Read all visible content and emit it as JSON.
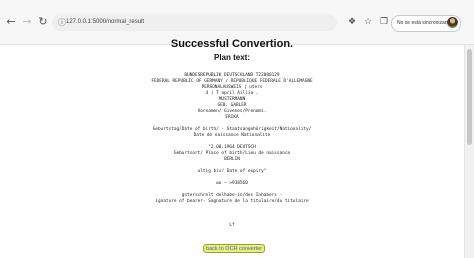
{
  "browser": {
    "url": "127.0.0.1:5000/normal_result",
    "profile_label": "No se está sincronizando"
  },
  "page": {
    "title": "Successful Convertion.",
    "subtitle": "Plan text:",
    "ocr_lines": [
      "BUNDESREPUBLIK DEUTSCHLAND T22000129",
      "FEDERAL REPUBLIC OF GERMANY / REPUBLIQUE FEDERALE D'ALLEMAGNE",
      "PERSONALAUSWEIS | uterv",
      "4 ) T april Aillia ,",
      "MUSTERMANN",
      "GEB. GABLER",
      "Vornamen/ Givenes/Prenoms.",
      "ERIKA",
      "",
      "Geburtstag/Date of birth/ - Staatsangehörigkeit/Nationality/",
      "Date de naissance Nationalite",
      "",
      "\"2.08.1964 DEUTSCH",
      "Geburtsort/ Place of birth/Lieu de naissance",
      "BERLIN",
      "",
      "ultig bis/ Date of expiry\"",
      "",
      "wo — >938560",
      "",
      "gnterschrelt delhabe-in/des Inhabers -",
      "ignature of bearer- Sagnature de la titulaire/du titulaire",
      "",
      "",
      "",
      "Lf"
    ],
    "back_button_label": "back to OCR converter"
  },
  "colors": {
    "button_bg": "#e9f26f",
    "link_text": "#3a5fcd"
  }
}
